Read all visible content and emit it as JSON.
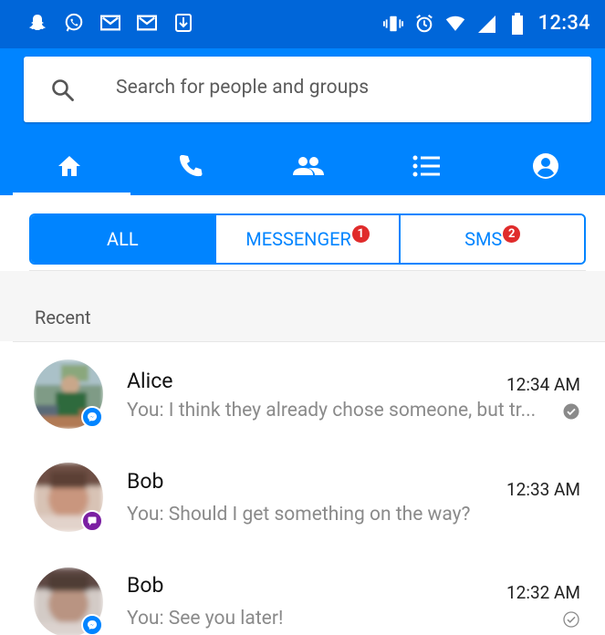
{
  "statusbar": {
    "time": "12:34",
    "left_icons": [
      "snapchat-icon",
      "whatsapp-icon",
      "gmail-icon",
      "gmail-icon",
      "download-icon"
    ],
    "right_icons": [
      "vibrate-icon",
      "alarm-icon",
      "wifi-icon",
      "signal-icon",
      "battery-icon"
    ]
  },
  "search": {
    "placeholder": "Search for people and groups"
  },
  "nav_tabs": [
    "home-icon",
    "phone-icon",
    "people-icon",
    "list-icon",
    "account-icon"
  ],
  "filter": {
    "all_label": "ALL",
    "messenger_label": "MESSENGER",
    "messenger_badge": "1",
    "sms_label": "SMS",
    "sms_badge": "2"
  },
  "section": {
    "title": "Recent"
  },
  "conversations": [
    {
      "name": "Alice",
      "time": "12:34 AM",
      "preview": "You: I think they already chose someone, but tr...",
      "status": "delivered-filled-check"
    },
    {
      "name": "Bob",
      "time": "12:33 AM",
      "preview": "You: Should I get something on the way?",
      "status": ""
    },
    {
      "name": "Bob",
      "time": "12:32 AM",
      "preview": "You: See you later!",
      "status": "sent-outline-check"
    }
  ],
  "colors": {
    "statusbar": "#0066d9",
    "primary": "#0084ff",
    "badge": "#e02b2b",
    "sms_badge": "#7b1fa2"
  }
}
